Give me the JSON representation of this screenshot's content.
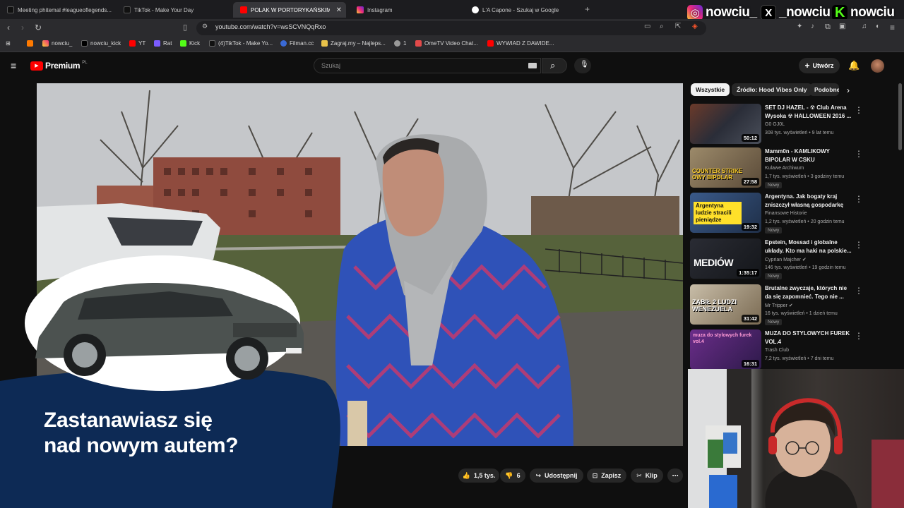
{
  "browser": {
    "tabs": [
      {
        "label": "Meeting phitemal #leagueoflegends..."
      },
      {
        "label": "TikTok - Make Your Day"
      },
      {
        "label": "POLAK W PORTORYKAŃSKIM..."
      },
      {
        "label": "Instagram"
      },
      {
        "label": "L'A Capone - Szukaj w Google"
      }
    ],
    "new_tab": "+",
    "url": "youtube.com/watch?v=wsSCVNQqRxo",
    "bookmarks": [
      {
        "label": ""
      },
      {
        "label": "nowciu_"
      },
      {
        "label": "nowciu_kick"
      },
      {
        "label": "YT"
      },
      {
        "label": "Rat"
      },
      {
        "label": "Kick"
      },
      {
        "label": "(4)TikTok - Make Yo..."
      },
      {
        "label": "Filman.cc"
      },
      {
        "label": "Zagraj.my – Najleps..."
      },
      {
        "label": "1"
      },
      {
        "label": "OmeTV Video Chat..."
      },
      {
        "label": "WYWIAD Z DAWIDE..."
      }
    ]
  },
  "socials": [
    {
      "icon": "instagram-icon",
      "handle": "nowciu_"
    },
    {
      "icon": "x-icon",
      "handle": "_nowciu"
    },
    {
      "icon": "kick-icon",
      "handle": "nowciu"
    }
  ],
  "youtube": {
    "logo": "Premium",
    "logo_sup": "PL",
    "search_placeholder": "Szukaj",
    "create_label": "Utwórz",
    "ad_text_line1": "Zastanawiasz się",
    "ad_text_line2": "nad nowym autem?",
    "actions": {
      "likes": "1,5 tys.",
      "dislikes": "6",
      "share": "Udostępnij",
      "save": "Zapisz",
      "clip": "Klip"
    },
    "chips": [
      "Wszystkie",
      "Źródło: Hood Vibes Only",
      "Podobne"
    ],
    "recommendations": [
      {
        "title": "SET DJ HAZEL - ☢ Club Arena Wysoka ☢ HALLOWEEN 2016 ...",
        "channel": "G0 GJ0L",
        "meta": "308 tys. wyświetleń • 9 lat temu",
        "duration": "50:12",
        "badge": "",
        "thumb_color": "#3b3f4a"
      },
      {
        "title": "Mamm0n - KAMLIKOWY BIPOLAR W CSKU",
        "channel": "Kulawe Archiwum",
        "meta": "1,7 tys. wyświetleń • 3 godziny temu",
        "duration": "27:58",
        "badge": "Nowy",
        "thumb_color": "#8a7c62",
        "thumb_text": "COUNTER STRIKE OWY BIPOLAR"
      },
      {
        "title": "Argentyna. Jak bogaty kraj zniszczył własną gospodarkę",
        "channel": "Finansowe Historie",
        "meta": "1,2 tys. wyświetleń • 20 godzin temu",
        "duration": "19:32",
        "badge": "Nowy",
        "thumb_color": "#2f4a6b",
        "thumb_text": "Argentyna ludzie stracili pieniądze"
      },
      {
        "title": "Epstein, Mossad i globalne układy. Kto ma haki na polskie...",
        "channel": "Cyprian Majcher ✔",
        "meta": "146 tys. wyświetleń • 19 godzin temu",
        "duration": "1:35:17",
        "badge": "Nowy",
        "thumb_color": "#1d1f24",
        "thumb_text": "MEDIÓW"
      },
      {
        "title": "Brutalne zwyczaje, których nie da się zapomnieć. Tego nie ...",
        "channel": "Mr Tripper ✔",
        "meta": "16 tys. wyświetleń • 1 dzień temu",
        "duration": "31:42",
        "badge": "Nowy",
        "thumb_color": "#a89c86",
        "thumb_text": "ZABIŁ 2 LUDZI WENEZUELA"
      },
      {
        "title": "MUZA DO STYLOWYCH FUREK VOL.4",
        "channel": "Trash Club",
        "meta": "7,2 tys. wyświetleń • 7 dni temu",
        "duration": "16:31",
        "badge": "",
        "thumb_color": "#4a2d6b",
        "thumb_text": "muza do stylowych furek vol.4"
      }
    ]
  },
  "colors": {
    "youtube_red": "#ff0000",
    "instagram": "#e1306c",
    "kick_green": "#53fc18",
    "ad_blue": "#0d2a55"
  }
}
